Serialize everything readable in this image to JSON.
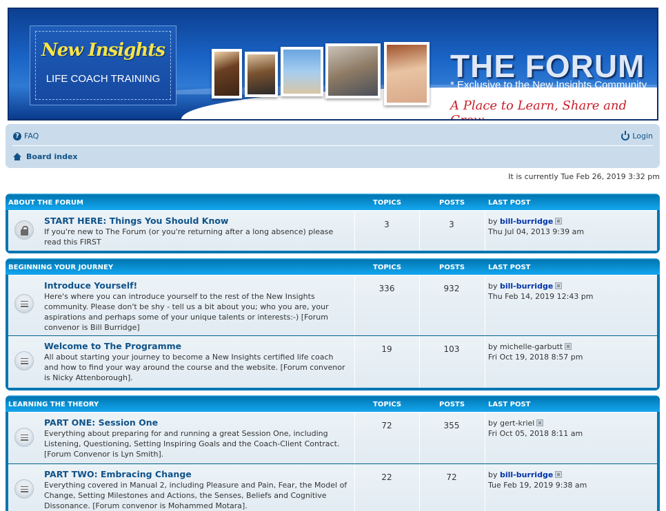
{
  "banner": {
    "logo_name": "New Insights",
    "logo_sub": "LIFE COACH TRAINING",
    "title": "THE FORUM",
    "subtitle": "* Exclusive to the New Insights Community",
    "tagline": "A Place to Learn, Share and Grow"
  },
  "nav": {
    "faq": "FAQ",
    "login": "Login",
    "board_index": "Board index"
  },
  "current_time": "It is currently Tue Feb 26, 2019 3:32 pm",
  "headers": {
    "topics": "TOPICS",
    "posts": "POSTS",
    "last_post": "LAST POST"
  },
  "sections": [
    {
      "title": "ABOUT THE FORUM",
      "forums": [
        {
          "title": "START HERE: Things You Should Know",
          "desc": "If you're new to The Forum (or you're returning after a long absence) please read this FIRST",
          "topics": "3",
          "posts": "3",
          "by": "by",
          "user": "bill-burridge",
          "date": "Thu Jul 04, 2013 9:39 am",
          "locked": true
        }
      ]
    },
    {
      "title": "BEGINNING YOUR JOURNEY",
      "forums": [
        {
          "title": "Introduce Yourself!",
          "desc": "Here's where you can introduce yourself to the rest of the New Insights community. Please don't be shy - tell us a bit about you; who you are, your aspirations and perhaps some of your unique talents or interests:-) [Forum convenor is Bill Burridge]",
          "topics": "336",
          "posts": "932",
          "by": "by",
          "user": "bill-burridge",
          "date": "Thu Feb 14, 2019 12:43 pm"
        },
        {
          "title": "Welcome to The Programme",
          "desc": "All about starting your journey to become a New Insights certified life coach and how to find your way around the course and the website. [Forum convenor is Nicky Attenborough].",
          "topics": "19",
          "posts": "103",
          "by": "by",
          "user": "michelle-garbutt",
          "date": "Fri Oct 19, 2018 8:57 pm"
        }
      ]
    },
    {
      "title": "LEARNING THE THEORY",
      "forums": [
        {
          "title": "PART ONE: Session One",
          "desc": "Everything about preparing for and running a great Session One, including Listening, Questioning, Setting Inspiring Goals and the Coach-Client Contract. [Forum Convenor is Lyn Smith].",
          "topics": "72",
          "posts": "355",
          "by": "by",
          "user": "gert-kriel",
          "date": "Fri Oct 05, 2018 8:11 am"
        },
        {
          "title": "PART TWO: Embracing Change",
          "desc": "Everything covered in Manual 2, including Pleasure and Pain, Fear, the Model of Change, Setting Milestones and Actions, the Senses, Beliefs and Cognitive Dissonance. [Forum convenor is Mohammed Motara].",
          "topics": "22",
          "posts": "72",
          "by": "by",
          "user": "bill-burridge",
          "date": "Tue Feb 19, 2019 9:38 am"
        }
      ]
    }
  ]
}
